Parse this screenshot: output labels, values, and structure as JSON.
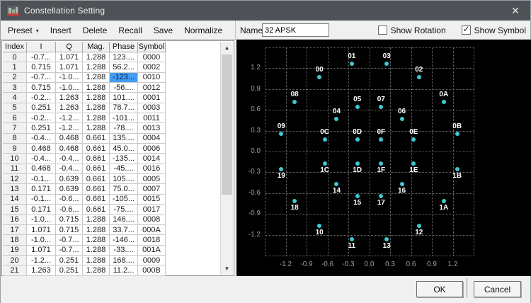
{
  "window": {
    "title": "Constellation Setting"
  },
  "icons": {
    "close": "✕",
    "caret_down": "▾",
    "check": "✓",
    "scroll_up": "▲",
    "scroll_down": "▼"
  },
  "toolbar": {
    "items": [
      {
        "label": "Preset",
        "has_caret": true
      },
      {
        "label": "Insert",
        "has_caret": false
      },
      {
        "label": "Delete",
        "has_caret": false
      },
      {
        "label": "Recall",
        "has_caret": false
      },
      {
        "label": "Save",
        "has_caret": false
      },
      {
        "label": "Normalize",
        "has_caret": false
      }
    ]
  },
  "name_field": {
    "label": "Name",
    "value": "32 APSK"
  },
  "options": [
    {
      "id": "show-rotation",
      "label": "Show Rotation",
      "checked": false
    },
    {
      "id": "show-symbol",
      "label": "Show Symbol",
      "checked": true
    }
  ],
  "table": {
    "columns": [
      "Index",
      "I",
      "Q",
      "Mag.",
      "Phase",
      "Symbol"
    ],
    "selection": {
      "row_index": 2,
      "column": "Phase"
    },
    "rows": [
      [
        "0",
        "-0.7...",
        "1.071",
        "1.288",
        "123....",
        "0000"
      ],
      [
        "1",
        "0.715",
        "1.071",
        "1.288",
        "56.2...",
        "0002"
      ],
      [
        "2",
        "-0.7...",
        "-1.0...",
        "1.288",
        "-123...",
        "0010"
      ],
      [
        "3",
        "0.715",
        "-1.0...",
        "1.288",
        "-56....",
        "0012"
      ],
      [
        "4",
        "-0.2...",
        "1.263",
        "1.288",
        "101....",
        "0001"
      ],
      [
        "5",
        "0.251",
        "1.263",
        "1.288",
        "78.7...",
        "0003"
      ],
      [
        "6",
        "-0.2...",
        "-1.2...",
        "1.288",
        "-101...",
        "0011"
      ],
      [
        "7",
        "0.251",
        "-1.2...",
        "1.288",
        "-78....",
        "0013"
      ],
      [
        "8",
        "-0.4...",
        "0.468",
        "0.661",
        "135....",
        "0004"
      ],
      [
        "9",
        "0.468",
        "0.468",
        "0.661",
        "45.0...",
        "0006"
      ],
      [
        "10",
        "-0.4...",
        "-0.4...",
        "0.661",
        "-135...",
        "0014"
      ],
      [
        "11",
        "0.468",
        "-0.4...",
        "0.661",
        "-45....",
        "0016"
      ],
      [
        "12",
        "-0.1...",
        "0.639",
        "0.661",
        "105....",
        "0005"
      ],
      [
        "13",
        "0.171",
        "0.639",
        "0.661",
        "75.0...",
        "0007"
      ],
      [
        "14",
        "-0.1...",
        "-0.6...",
        "0.661",
        "-105...",
        "0015"
      ],
      [
        "15",
        "0.171",
        "-0.6...",
        "0.661",
        "-75....",
        "0017"
      ],
      [
        "16",
        "-1.0...",
        "0.715",
        "1.288",
        "146....",
        "0008"
      ],
      [
        "17",
        "1.071",
        "0.715",
        "1.288",
        "33.7...",
        "000A"
      ],
      [
        "18",
        "-1.0...",
        "-0.7...",
        "1.288",
        "-146...",
        "0018"
      ],
      [
        "19",
        "1.071",
        "-0.7...",
        "1.288",
        "-33....",
        "001A"
      ],
      [
        "20",
        "-1.2...",
        "0.251",
        "1.288",
        "168....",
        "0009"
      ],
      [
        "21",
        "1.263",
        "0.251",
        "1.288",
        "11.2...",
        "000B"
      ]
    ]
  },
  "footer": {
    "ok_label": "OK",
    "cancel_label": "Cancel"
  },
  "chart_data": {
    "type": "scatter",
    "title": "32 APSK constellation",
    "xlim": [
      -1.5,
      1.5
    ],
    "ylim": [
      -1.5,
      1.5
    ],
    "grid": true,
    "grid_values": [
      -1.5,
      -1.2,
      -0.9,
      -0.6,
      -0.3,
      0.0,
      0.3,
      0.6,
      0.9,
      1.2,
      1.5
    ],
    "x_ticks": [
      -1.2,
      -0.9,
      -0.6,
      -0.3,
      0.0,
      0.3,
      0.6,
      0.9,
      1.2
    ],
    "x_tick_labels": [
      "-1.2",
      "-0.9",
      "-0.6",
      "-0.3",
      "0.0",
      "0.3",
      "0.6",
      "0.9",
      "1.2"
    ],
    "y_ticks": [
      1.2,
      0.9,
      0.6,
      0.3,
      0.0,
      -0.3,
      -0.6,
      -0.9,
      -1.2
    ],
    "y_tick_labels": [
      "1.2",
      "0.9",
      "0.6",
      "0.3",
      "0.0",
      "-0.3",
      "-0.6",
      "-0.9",
      "-1.2"
    ],
    "point_color": "#3ec9d2",
    "label_color": "#ffffff",
    "points": [
      {
        "symbol": "00",
        "i": -0.715,
        "q": 1.071
      },
      {
        "symbol": "01",
        "i": -0.251,
        "q": 1.263
      },
      {
        "symbol": "02",
        "i": 0.715,
        "q": 1.071
      },
      {
        "symbol": "03",
        "i": 0.251,
        "q": 1.263
      },
      {
        "symbol": "04",
        "i": -0.468,
        "q": 0.468
      },
      {
        "symbol": "05",
        "i": -0.171,
        "q": 0.639
      },
      {
        "symbol": "06",
        "i": 0.468,
        "q": 0.468
      },
      {
        "symbol": "07",
        "i": 0.171,
        "q": 0.639
      },
      {
        "symbol": "08",
        "i": -1.071,
        "q": 0.715
      },
      {
        "symbol": "09",
        "i": -1.263,
        "q": 0.251
      },
      {
        "symbol": "0A",
        "i": 1.071,
        "q": 0.715
      },
      {
        "symbol": "0B",
        "i": 1.263,
        "q": 0.251
      },
      {
        "symbol": "0C",
        "i": -0.639,
        "q": 0.171
      },
      {
        "symbol": "0D",
        "i": -0.171,
        "q": 0.171
      },
      {
        "symbol": "0E",
        "i": 0.639,
        "q": 0.171
      },
      {
        "symbol": "0F",
        "i": 0.171,
        "q": 0.171
      },
      {
        "symbol": "10",
        "i": -0.715,
        "q": -1.071
      },
      {
        "symbol": "11",
        "i": -0.251,
        "q": -1.263
      },
      {
        "symbol": "12",
        "i": 0.715,
        "q": -1.071
      },
      {
        "symbol": "13",
        "i": 0.251,
        "q": -1.263
      },
      {
        "symbol": "14",
        "i": -0.468,
        "q": -0.468
      },
      {
        "symbol": "15",
        "i": -0.171,
        "q": -0.639
      },
      {
        "symbol": "16",
        "i": 0.468,
        "q": -0.468
      },
      {
        "symbol": "17",
        "i": 0.171,
        "q": -0.639
      },
      {
        "symbol": "18",
        "i": -1.071,
        "q": -0.715
      },
      {
        "symbol": "19",
        "i": -1.263,
        "q": -0.251
      },
      {
        "symbol": "1A",
        "i": 1.071,
        "q": -0.715
      },
      {
        "symbol": "1B",
        "i": 1.263,
        "q": -0.251
      },
      {
        "symbol": "1C",
        "i": -0.639,
        "q": -0.171
      },
      {
        "symbol": "1D",
        "i": -0.171,
        "q": -0.171
      },
      {
        "symbol": "1E",
        "i": 0.639,
        "q": -0.171
      },
      {
        "symbol": "1F",
        "i": 0.171,
        "q": -0.171
      }
    ]
  }
}
